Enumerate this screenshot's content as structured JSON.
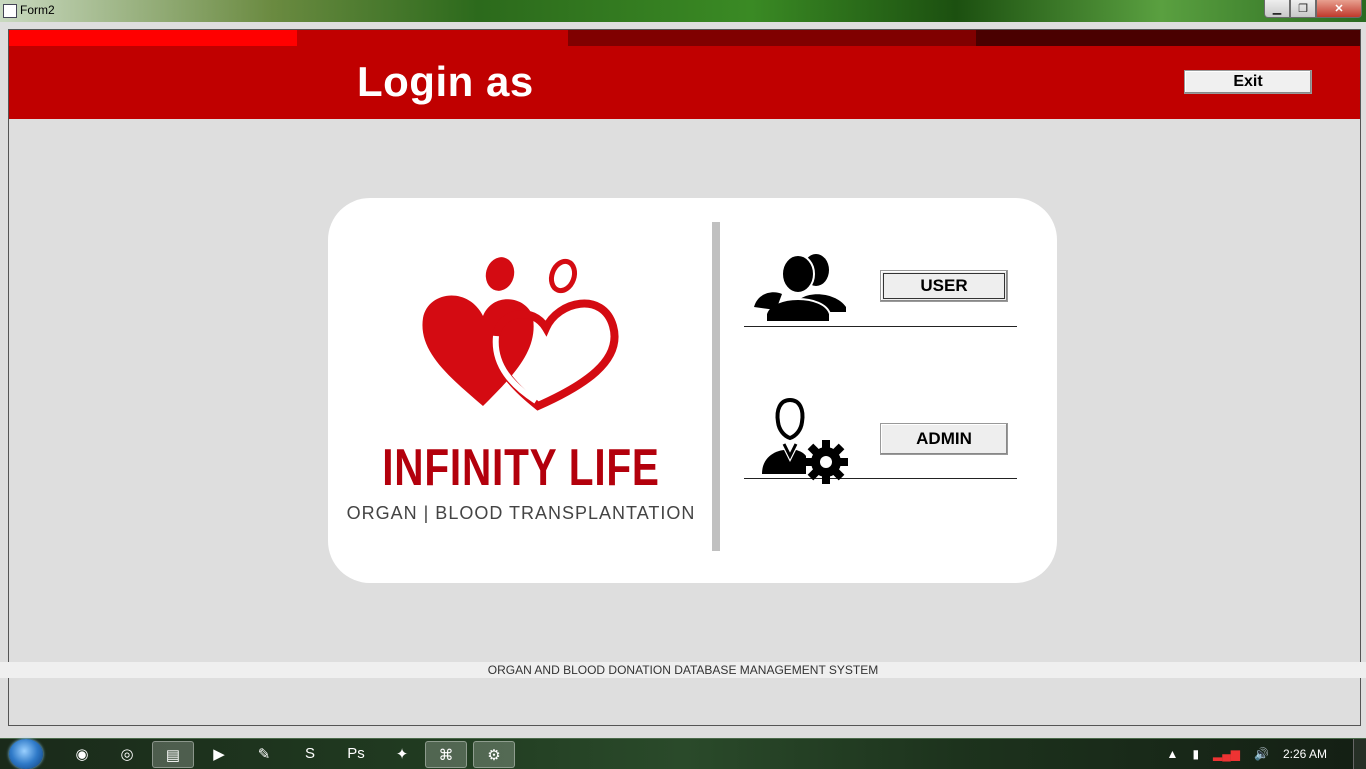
{
  "window": {
    "title": "Form2",
    "minimize": "▁",
    "maximize": "❐",
    "close": "✕"
  },
  "header": {
    "title": "Login as",
    "exit_label": "Exit"
  },
  "brand": {
    "name": "INFINITY LIFE",
    "tagline": "ORGAN | BLOOD  TRANSPLANTATION"
  },
  "roles": {
    "user_label": "USER",
    "admin_label": "ADMIN"
  },
  "footer": {
    "text": "ORGAN AND BLOOD DONATION DATABASE MANAGEMENT SYSTEM"
  },
  "taskbar": {
    "apps": [
      {
        "name": "firefox",
        "glyph": "◉"
      },
      {
        "name": "chrome",
        "glyph": "◎"
      },
      {
        "name": "explorer",
        "glyph": "▤"
      },
      {
        "name": "media-player",
        "glyph": "▶"
      },
      {
        "name": "notepad",
        "glyph": "✎"
      },
      {
        "name": "sublime",
        "glyph": "S"
      },
      {
        "name": "photoshop",
        "glyph": "Ps"
      },
      {
        "name": "app-8",
        "glyph": "✦"
      },
      {
        "name": "app-9",
        "glyph": "⌘"
      },
      {
        "name": "app-10",
        "glyph": "⚙"
      }
    ],
    "tray": {
      "arrow": "▲",
      "battery": "▮",
      "signal": "▂▄▆",
      "volume": "🔊",
      "clock": "2:26 AM"
    }
  },
  "colors": {
    "header_red": "#c00000",
    "brand_red": "#b3000c"
  }
}
